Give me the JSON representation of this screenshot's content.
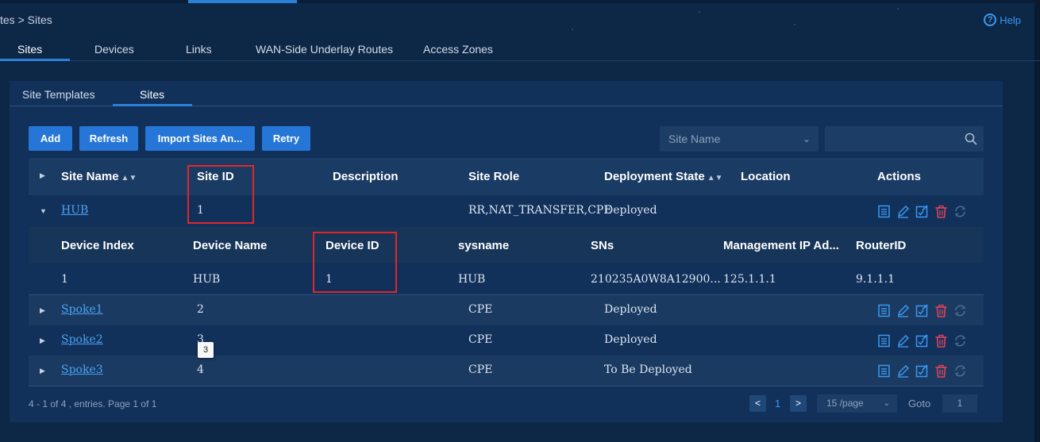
{
  "breadcrumb": "tes > Sites",
  "help_label": "Help",
  "top_tabs": [
    "Sites",
    "Devices",
    "Links",
    "WAN-Side Underlay Routes",
    "Access Zones"
  ],
  "sub_tabs": [
    "Site Templates",
    "Sites"
  ],
  "toolbar": {
    "add": "Add",
    "refresh": "Refresh",
    "import": "Import Sites An...",
    "retry": "Retry"
  },
  "filter": {
    "select_value": "Site Name",
    "search_value": ""
  },
  "table": {
    "headers": [
      "Site Name",
      "Site ID",
      "Description",
      "Site Role",
      "Deployment State",
      "Location",
      "Actions"
    ],
    "rows": [
      {
        "name": "HUB",
        "id": "1",
        "description": "",
        "role": "RR,NAT_TRANSFER,CPE",
        "state": "Deployed",
        "location": "",
        "expanded": true
      },
      {
        "name": "Spoke1",
        "id": "2",
        "description": "",
        "role": "CPE",
        "state": "Deployed",
        "location": "",
        "expanded": false
      },
      {
        "name": "Spoke2",
        "id": "3",
        "description": "",
        "role": "CPE",
        "state": "Deployed",
        "location": "",
        "expanded": false
      },
      {
        "name": "Spoke3",
        "id": "4",
        "description": "",
        "role": "CPE",
        "state": "To Be Deployed",
        "location": "",
        "expanded": false
      }
    ]
  },
  "device_table": {
    "headers": [
      "Device Index",
      "Device Name",
      "Device ID",
      "sysname",
      "SNs",
      "Management IP Ad...",
      "RouterID"
    ],
    "rows": [
      {
        "index": "1",
        "name": "HUB",
        "id": "1",
        "sysname": "HUB",
        "sns": "210235A0W8A12900...",
        "mgmt_ip": "125.1.1.1",
        "router_id": "9.1.1.1"
      }
    ]
  },
  "tooltip": "3",
  "pagination": {
    "summary": "4 - 1 of 4 , entries. Page 1 of 1",
    "prev": "<",
    "page": "1",
    "next": ">",
    "page_size": "15 /page",
    "goto_label": "Goto",
    "goto_value": "1"
  },
  "colors": {
    "accent": "#2676d8",
    "link": "#4aa3f5",
    "danger": "#e0262b",
    "delete_icon": "#e0435a"
  }
}
